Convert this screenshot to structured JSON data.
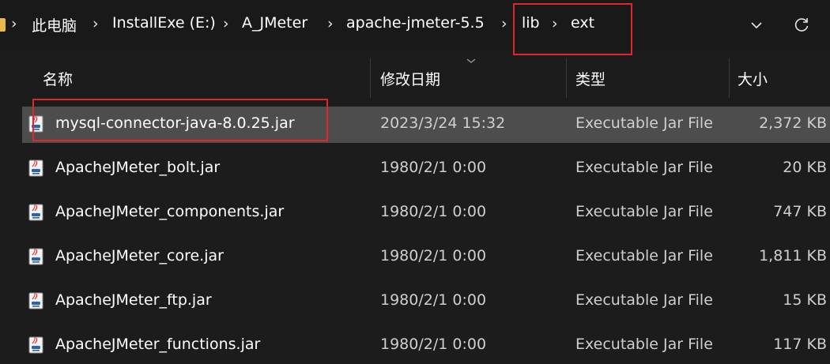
{
  "breadcrumb": {
    "items": [
      "此电脑",
      "InstallExe (E:)",
      "A_JMeter",
      "apache-jmeter-5.5",
      "lib",
      "ext"
    ]
  },
  "icons": {
    "folder": "folder-icon",
    "separator": "chevron-right-icon",
    "dropdown": "chevron-down-icon",
    "refresh": "refresh-icon",
    "sort": "sort-chevron-icon",
    "file": "java-jar-file-icon"
  },
  "columns": {
    "name": "名称",
    "date": "修改日期",
    "type": "类型",
    "size": "大小"
  },
  "files": [
    {
      "name": "mysql-connector-java-8.0.25.jar",
      "date": "2023/3/24 15:32",
      "type": "Executable Jar File",
      "size": "2,372 KB",
      "selected": true
    },
    {
      "name": "ApacheJMeter_bolt.jar",
      "date": "1980/2/1 0:00",
      "type": "Executable Jar File",
      "size": "20 KB"
    },
    {
      "name": "ApacheJMeter_components.jar",
      "date": "1980/2/1 0:00",
      "type": "Executable Jar File",
      "size": "747 KB"
    },
    {
      "name": "ApacheJMeter_core.jar",
      "date": "1980/2/1 0:00",
      "type": "Executable Jar File",
      "size": "1,811 KB"
    },
    {
      "name": "ApacheJMeter_ftp.jar",
      "date": "1980/2/1 0:00",
      "type": "Executable Jar File",
      "size": "15 KB"
    },
    {
      "name": "ApacheJMeter_functions.jar",
      "date": "1980/2/1 0:00",
      "type": "Executable Jar File",
      "size": "117 KB"
    }
  ],
  "colors": {
    "background": "#1c1c1c",
    "selected_row": "#4d4d4d",
    "highlight_box": "#e0262b",
    "folder": "#e8b84a"
  }
}
